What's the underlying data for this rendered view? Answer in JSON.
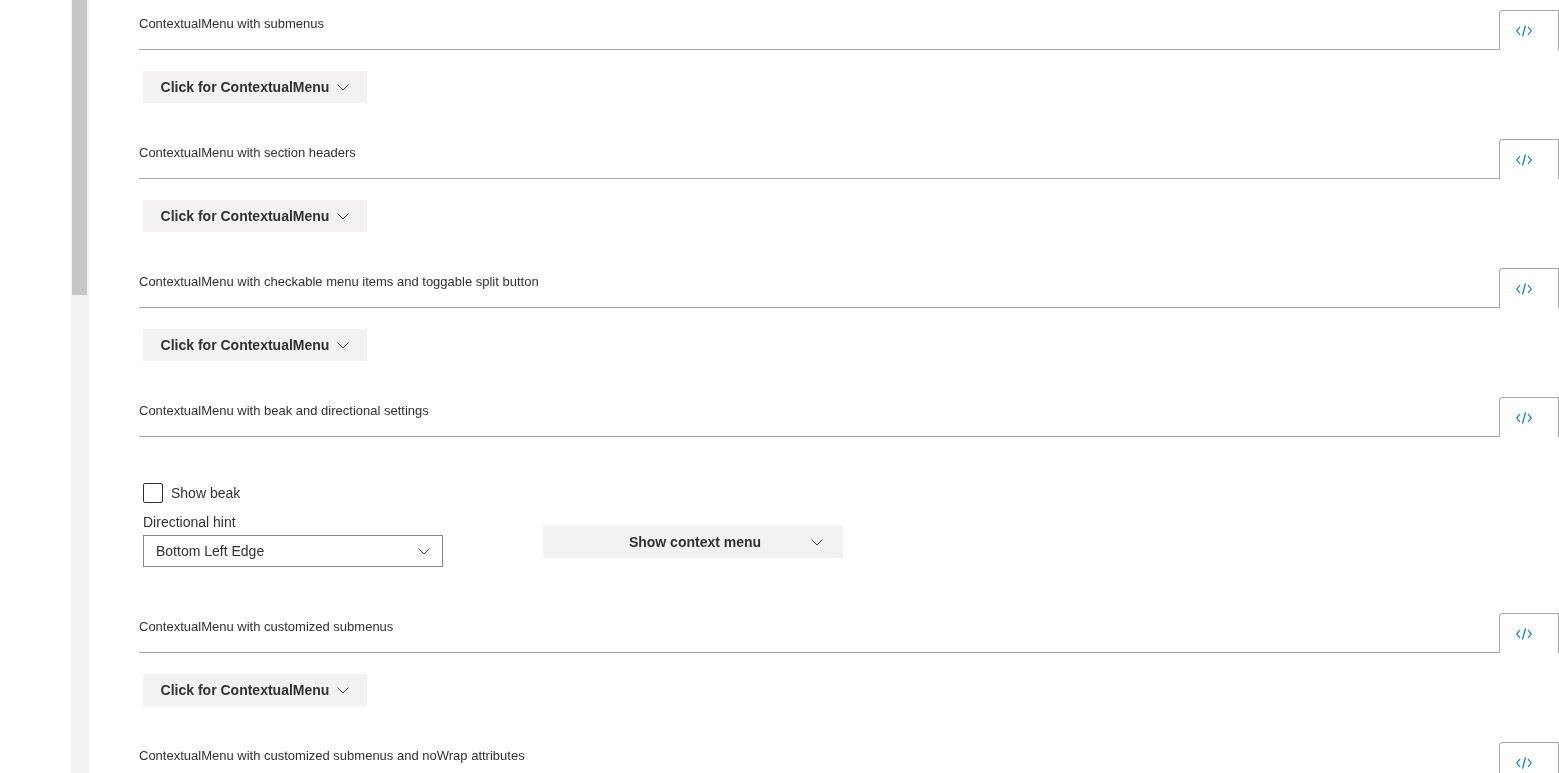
{
  "sections": [
    {
      "kind": "button",
      "title": "ContextualMenu with submenus",
      "button": "Click for ContextualMenu"
    },
    {
      "kind": "button",
      "title": "ContextualMenu with section headers",
      "button": "Click for ContextualMenu"
    },
    {
      "kind": "button",
      "title": "ContextualMenu with checkable menu items and toggable split button",
      "button": "Click for ContextualMenu"
    },
    {
      "kind": "beak",
      "title": "ContextualMenu with beak and directional settings",
      "checkbox": {
        "label": "Show beak",
        "checked": false
      },
      "dropdown": {
        "label": "Directional hint",
        "value": "Bottom Left Edge"
      },
      "button": "Show context menu"
    },
    {
      "kind": "button",
      "title": "ContextualMenu with customized submenus",
      "button": "Click for ContextualMenu"
    },
    {
      "kind": "title",
      "title": "ContextualMenu with customized submenus and noWrap attributes"
    }
  ]
}
